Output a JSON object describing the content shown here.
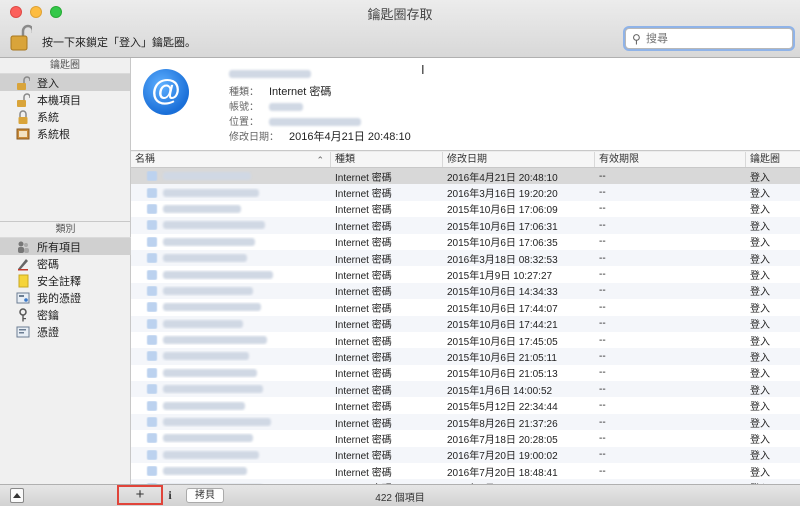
{
  "window": {
    "title": "鑰匙圈存取"
  },
  "toolbar": {
    "lock_hint": "按一下來鎖定「登入」鑰匙圈。",
    "search_placeholder": "搜尋"
  },
  "sidebar": {
    "keychains_header": "鑰匙圈",
    "keychains": [
      {
        "label": "登入",
        "icon": "lock-open-icon",
        "selected": true
      },
      {
        "label": "本機項目",
        "icon": "lock-open-icon",
        "selected": false
      },
      {
        "label": "系統",
        "icon": "lock-icon",
        "selected": false
      },
      {
        "label": "系統根",
        "icon": "cabinet-icon",
        "selected": false
      }
    ],
    "categories_header": "類別",
    "categories": [
      {
        "label": "所有項目",
        "icon": "people-icon",
        "selected": true
      },
      {
        "label": "密碼",
        "icon": "pencil-icon",
        "selected": false
      },
      {
        "label": "安全註釋",
        "icon": "note-icon",
        "selected": false
      },
      {
        "label": "我的憑證",
        "icon": "certificate-icon",
        "selected": false
      },
      {
        "label": "密鑰",
        "icon": "key-icon",
        "selected": false
      },
      {
        "label": "憑證",
        "icon": "certificate-icon",
        "selected": false
      }
    ]
  },
  "detail": {
    "kind_label": "種類：",
    "kind_value": "Internet 密碼",
    "account_label": "帳號：",
    "location_label": "位置：",
    "modified_label": "修改日期：",
    "modified_value": "2016年4月21日 20:48:10"
  },
  "table": {
    "columns": [
      "名稱",
      "種類",
      "修改日期",
      "有效期限",
      "鑰匙圈"
    ],
    "rows": [
      {
        "kind": "Internet 密碼",
        "date": "2016年4月21日 20:48:10",
        "expiry": "--",
        "keychain": "登入"
      },
      {
        "kind": "Internet 密碼",
        "date": "2016年3月16日 19:20:20",
        "expiry": "--",
        "keychain": "登入"
      },
      {
        "kind": "Internet 密碼",
        "date": "2015年10月6日 17:06:09",
        "expiry": "--",
        "keychain": "登入"
      },
      {
        "kind": "Internet 密碼",
        "date": "2015年10月6日 17:06:31",
        "expiry": "--",
        "keychain": "登入"
      },
      {
        "kind": "Internet 密碼",
        "date": "2015年10月6日 17:06:35",
        "expiry": "--",
        "keychain": "登入"
      },
      {
        "kind": "Internet 密碼",
        "date": "2016年3月18日 08:32:53",
        "expiry": "--",
        "keychain": "登入"
      },
      {
        "kind": "Internet 密碼",
        "date": "2015年1月9日 10:27:27",
        "expiry": "--",
        "keychain": "登入"
      },
      {
        "kind": "Internet 密碼",
        "date": "2015年10月6日 14:34:33",
        "expiry": "--",
        "keychain": "登入"
      },
      {
        "kind": "Internet 密碼",
        "date": "2015年10月6日 17:44:07",
        "expiry": "--",
        "keychain": "登入"
      },
      {
        "kind": "Internet 密碼",
        "date": "2015年10月6日 17:44:21",
        "expiry": "--",
        "keychain": "登入"
      },
      {
        "kind": "Internet 密碼",
        "date": "2015年10月6日 17:45:05",
        "expiry": "--",
        "keychain": "登入"
      },
      {
        "kind": "Internet 密碼",
        "date": "2015年10月6日 21:05:11",
        "expiry": "--",
        "keychain": "登入"
      },
      {
        "kind": "Internet 密碼",
        "date": "2015年10月6日 21:05:13",
        "expiry": "--",
        "keychain": "登入"
      },
      {
        "kind": "Internet 密碼",
        "date": "2015年1月6日 14:00:52",
        "expiry": "--",
        "keychain": "登入"
      },
      {
        "kind": "Internet 密碼",
        "date": "2015年5月12日 22:34:44",
        "expiry": "--",
        "keychain": "登入"
      },
      {
        "kind": "Internet 密碼",
        "date": "2015年8月26日 21:37:26",
        "expiry": "--",
        "keychain": "登入"
      },
      {
        "kind": "Internet 密碼",
        "date": "2016年7月18日 20:28:05",
        "expiry": "--",
        "keychain": "登入"
      },
      {
        "kind": "Internet 密碼",
        "date": "2016年7月20日 19:00:02",
        "expiry": "--",
        "keychain": "登入"
      },
      {
        "kind": "Internet 密碼",
        "date": "2016年7月20日 18:48:41",
        "expiry": "--",
        "keychain": "登入"
      },
      {
        "kind": "Internet 密碼",
        "date": "2016年7月20日 18:53:51",
        "expiry": "--",
        "keychain": "登入"
      }
    ]
  },
  "bottombar": {
    "add": "+",
    "info": "i",
    "copy": "拷貝",
    "count": "422 個項目"
  }
}
